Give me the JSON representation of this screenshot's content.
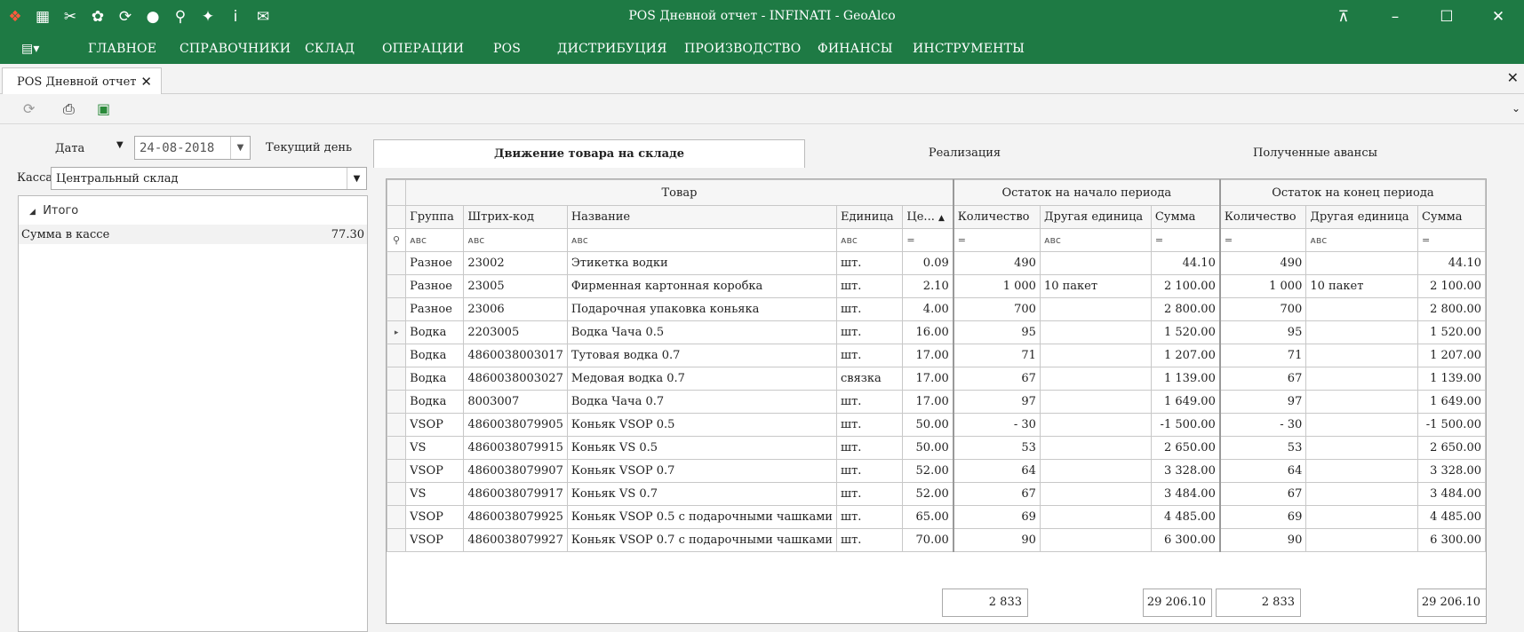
{
  "window": {
    "title": "POS Дневной отчет - INFINATI - GeoAlco"
  },
  "menu": [
    "ГЛАВНОЕ",
    "СПРАВОЧНИКИ",
    "СКЛАД",
    "ОПЕРАЦИИ",
    "POS",
    "ДИСТРИБУЦИЯ",
    "ПРОИЗВОДСТВО",
    "ФИНАНСЫ",
    "ИНСТРУМЕНТЫ"
  ],
  "doc_tab": {
    "label": "POS Дневной отчет"
  },
  "filters": {
    "date_label": "Дата",
    "date_value": "24-08-2018",
    "current_day": "Текущий день",
    "kassa_label": "Касса",
    "kassa_value": "Центральный склад"
  },
  "summary": {
    "group": "Итого",
    "rows": [
      {
        "label": "Сумма в кассе",
        "value": "77.30"
      }
    ]
  },
  "tabs": [
    "Движение товара на складе",
    "Реализация",
    "Полученные авансы"
  ],
  "grid": {
    "bands": [
      "Товар",
      "Остаток на начало периода",
      "Остаток на конец периода"
    ],
    "columns": [
      "Группа",
      "Штрих-код",
      "Название",
      "Единица",
      "Це...",
      "Количество",
      "Другая единица",
      "Сумма",
      "Количество",
      "Другая единица",
      "Сумма"
    ],
    "rows": [
      [
        "Разное",
        "23002",
        "Этикетка водки",
        "шт.",
        "0.09",
        "490",
        "",
        "44.10",
        "490",
        "",
        "44.10"
      ],
      [
        "Разное",
        "23005",
        "Фирменная картонная коробка",
        "шт.",
        "2.10",
        "1 000",
        "10  пакет",
        "2 100.00",
        "1 000",
        "10  пакет",
        "2 100.00"
      ],
      [
        "Разное",
        "23006",
        "Подарочная упаковка коньяка",
        "шт.",
        "4.00",
        "700",
        "",
        "2 800.00",
        "700",
        "",
        "2 800.00"
      ],
      [
        "Водка",
        "2203005",
        "Водка Чача 0.5",
        "шт.",
        "16.00",
        "95",
        "",
        "1 520.00",
        "95",
        "",
        "1 520.00"
      ],
      [
        "Водка",
        "4860038003017",
        "Тутовая водка 0.7",
        "шт.",
        "17.00",
        "71",
        "",
        "1 207.00",
        "71",
        "",
        "1 207.00"
      ],
      [
        "Водка",
        "4860038003027",
        "Медовая водка 0.7",
        "связка",
        "17.00",
        "67",
        "",
        "1 139.00",
        "67",
        "",
        "1 139.00"
      ],
      [
        "Водка",
        "8003007",
        "Водка Чача 0.7",
        "шт.",
        "17.00",
        "97",
        "",
        "1 649.00",
        "97",
        "",
        "1 649.00"
      ],
      [
        "VSOP",
        "4860038079905",
        "Коньяк VSOP 0.5",
        "шт.",
        "50.00",
        "-  30",
        "",
        "-1 500.00",
        "-  30",
        "",
        "-1 500.00"
      ],
      [
        "VS",
        "4860038079915",
        "Коньяк VS 0.5",
        "шт.",
        "50.00",
        "53",
        "",
        "2 650.00",
        "53",
        "",
        "2 650.00"
      ],
      [
        "VSOP",
        "4860038079907",
        "Коньяк VSOP 0.7",
        "шт.",
        "52.00",
        "64",
        "",
        "3 328.00",
        "64",
        "",
        "3 328.00"
      ],
      [
        "VS",
        "4860038079917",
        "Коньяк VS 0.7",
        "шт.",
        "52.00",
        "67",
        "",
        "3 484.00",
        "67",
        "",
        "3 484.00"
      ],
      [
        "VSOP",
        "4860038079925",
        "Коньяк VSOP 0.5  с подарочными чашками",
        "шт.",
        "65.00",
        "69",
        "",
        "4 485.00",
        "69",
        "",
        "4 485.00"
      ],
      [
        "VSOP",
        "4860038079927",
        "Коньяк VSOP 0.7 с подарочными чашками",
        "шт.",
        "70.00",
        "90",
        "",
        "6 300.00",
        "90",
        "",
        "6 300.00"
      ]
    ],
    "totals": {
      "qty_start": "2 833",
      "sum_start": "29 206.10",
      "qty_end": "2 833",
      "sum_end": "29 206.10"
    }
  }
}
